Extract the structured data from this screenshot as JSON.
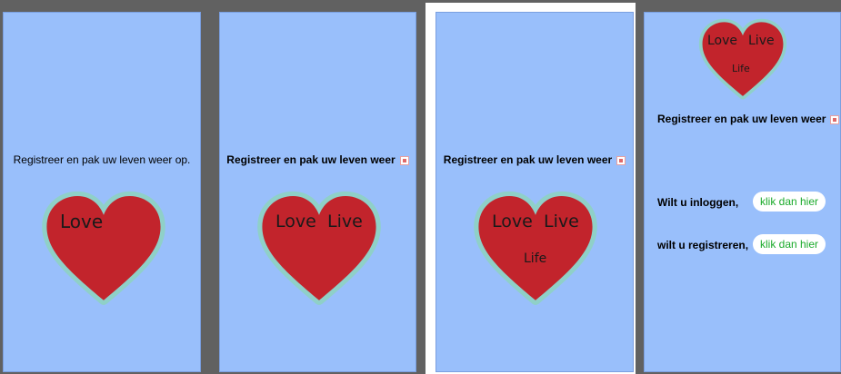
{
  "colors": {
    "background": "#616161",
    "screen": "#99bffb",
    "heart_fill": "#c2242c",
    "heart_glow": "#8fd0c8",
    "link_text": "#1aaa2a"
  },
  "screen1": {
    "tagline": "Registreer en pak uw leven weer op.",
    "heart_words": [
      "Love"
    ]
  },
  "screen2": {
    "tagline": "Registreer en pak uw leven weer",
    "broken_image_icon": "broken-image-icon",
    "heart_words": [
      "Love",
      "Live"
    ]
  },
  "screen3": {
    "tagline": "Registreer en pak uw leven weer",
    "broken_image_icon": "broken-image-icon",
    "heart_words": [
      "Love",
      "Live",
      "Life"
    ]
  },
  "screen4": {
    "heart_words": [
      "Love",
      "Live",
      "Life"
    ],
    "tagline": "Registreer en pak uw leven weer",
    "broken_image_icon": "broken-image-icon",
    "login_label": "Wilt u inloggen,",
    "login_button": "klik dan hier",
    "register_label": "wilt u registreren,",
    "register_button": "klik dan hier"
  }
}
